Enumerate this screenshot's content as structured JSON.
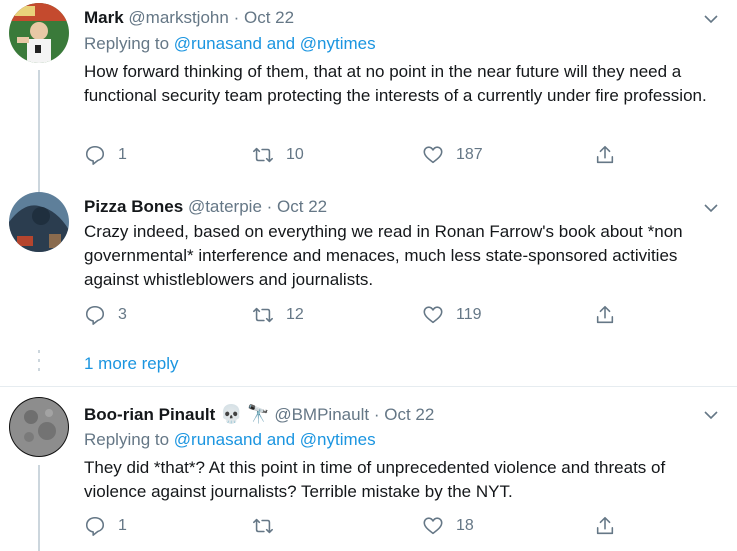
{
  "tweets": [
    {
      "name": "Mark",
      "handle": "@markstjohn",
      "separator": "·",
      "date": "Oct 22",
      "replying_prefix": "Replying to",
      "reply_user1": "@runasand",
      "reply_and": "and",
      "reply_user2": "@nytimes",
      "text": "How forward thinking of them, that at no point in the near future will they need a functional security team protecting the interests of a currently under fire profession.",
      "replies": "1",
      "retweets": "10",
      "likes": "187"
    },
    {
      "name": "Pizza Bones",
      "handle": "@taterpie",
      "separator": "·",
      "date": "Oct 22",
      "text": "Crazy indeed, based on everything we read in Ronan Farrow's book about *non governmental* interference and menaces, much less state-sponsored activities against whistleblowers and journalists.",
      "replies": "3",
      "retweets": "12",
      "likes": "119"
    },
    {
      "name": "Boo-rian Pinault",
      "emoji1": "💀",
      "emoji2": "🔭",
      "handle": "@BMPinault",
      "separator": "·",
      "date": "Oct 22",
      "replying_prefix": "Replying to",
      "reply_user1": "@runasand",
      "reply_and": "and",
      "reply_user2": "@nytimes",
      "text": "They did *that*? At this point in time of unprecedented violence and threats of violence against journalists? Terrible mistake by the NYT.",
      "replies": "1",
      "retweets": "",
      "likes": "18"
    }
  ],
  "more_reply": "1 more reply",
  "icons": [
    "reply-icon",
    "retweet-icon",
    "like-icon",
    "share-icon",
    "chevron-down-icon"
  ],
  "colors": {
    "link": "#1b95e0",
    "muted": "#657786",
    "divider": "#e6ecf0"
  }
}
